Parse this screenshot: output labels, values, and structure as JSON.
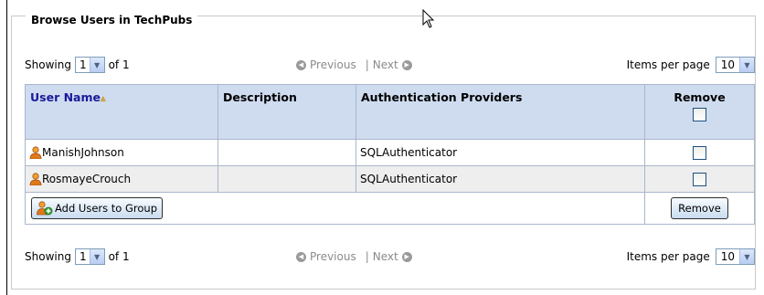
{
  "panel": {
    "title": "Browse Users in TechPubs"
  },
  "pager_top": {
    "showing_label": "Showing",
    "page_value": "1",
    "of_label": "of 1",
    "previous_label": "Previous",
    "separator": "|",
    "next_label": "Next",
    "items_per_page_label": "Items per page",
    "items_per_page_value": "10"
  },
  "pager_bottom": {
    "showing_label": "Showing",
    "page_value": "1",
    "of_label": "of 1",
    "previous_label": "Previous",
    "separator": "|",
    "next_label": "Next",
    "items_per_page_label": "Items per page",
    "items_per_page_value": "10"
  },
  "table": {
    "headers": {
      "user_name": "User Name",
      "description": "Description",
      "auth_providers": "Authentication Providers",
      "remove": "Remove"
    },
    "rows": [
      {
        "user_name": "ManishJohnson",
        "description": "",
        "auth_provider": "SQLAuthenticator"
      },
      {
        "user_name": "RosmayeCrouch",
        "description": "",
        "auth_provider": "SQLAuthenticator"
      }
    ],
    "add_button_label": "Add Users to Group",
    "remove_button_label": "Remove"
  }
}
